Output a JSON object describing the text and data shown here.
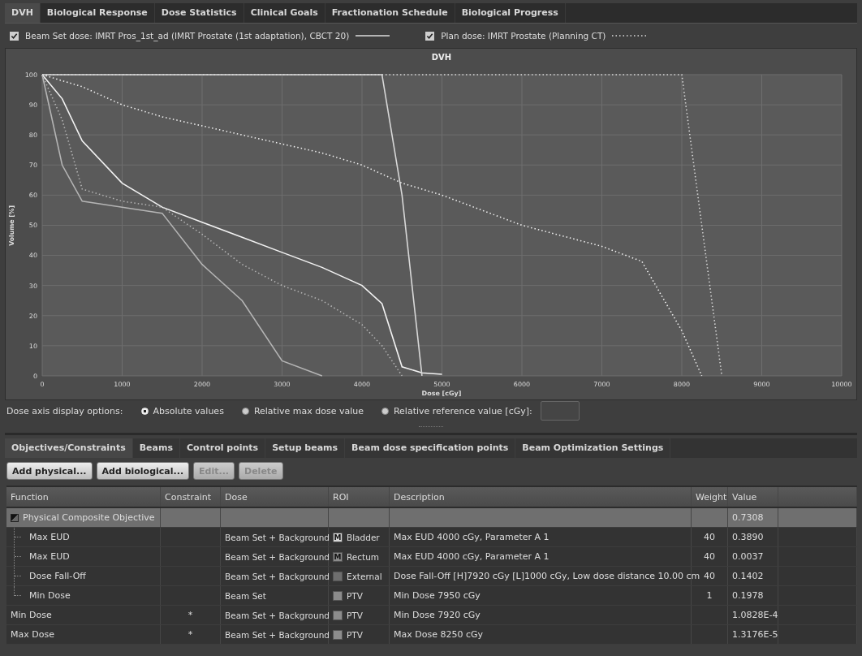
{
  "tabs": [
    {
      "label": "DVH",
      "selected": true
    },
    {
      "label": "Biological Response",
      "selected": false
    },
    {
      "label": "Dose Statistics",
      "selected": false
    },
    {
      "label": "Clinical Goals",
      "selected": false
    },
    {
      "label": "Fractionation Schedule",
      "selected": false
    },
    {
      "label": "Biological Progress",
      "selected": false
    }
  ],
  "legend": [
    {
      "label": "Beam Set dose: IMRT Pros_1st_ad (IMRT Prostate (1st adaptation), CBCT 20)",
      "checked": true,
      "dotted": false
    },
    {
      "label": "Plan dose: IMRT Prostate (Planning CT)",
      "checked": true,
      "dotted": true
    }
  ],
  "dvh": {
    "chart_data": {
      "type": "line",
      "title": "DVH",
      "xlabel": "Dose [cGy]",
      "ylabel": "Volume [%]",
      "xlim": [
        0,
        10000
      ],
      "ylim": [
        0,
        100
      ],
      "grid": true,
      "xticks": [
        0,
        1000,
        2000,
        3000,
        4000,
        5000,
        6000,
        7000,
        8000,
        9000,
        10000
      ],
      "yticks": [
        0,
        10,
        20,
        30,
        40,
        50,
        60,
        70,
        80,
        90,
        100
      ],
      "x": [
        0,
        250,
        500,
        1000,
        1500,
        2000,
        2500,
        3000,
        3500,
        4000,
        4250,
        4500,
        4750,
        5000,
        6000,
        7000,
        7500,
        8000,
        8250,
        8500
      ],
      "series": [
        {
          "color": "#f2f2f2",
          "line_style": "solid",
          "values": [
            100,
            92,
            78,
            64,
            56,
            51,
            46,
            41,
            36,
            30,
            24,
            3,
            1,
            0.5,
            null,
            null,
            null,
            null,
            null,
            null
          ]
        },
        {
          "color": "#b4b4b4",
          "line_style": "solid",
          "values": [
            100,
            70,
            58,
            56,
            54,
            37,
            25,
            5,
            0,
            null,
            null,
            null,
            null,
            null,
            null,
            null,
            null,
            null,
            null,
            null
          ]
        },
        {
          "color": "#d8d8d8",
          "line_style": "solid",
          "values": [
            100,
            100,
            100,
            100,
            100,
            100,
            100,
            100,
            100,
            100,
            100,
            60,
            0,
            null,
            null,
            null,
            null,
            null,
            null,
            null
          ]
        },
        {
          "color": "#b4b4b4",
          "line_style": "dotted",
          "values": [
            100,
            85,
            62,
            58,
            56,
            47,
            37,
            30,
            25,
            17,
            10,
            0,
            null,
            null,
            null,
            null,
            null,
            null,
            null,
            null
          ]
        },
        {
          "color": "#f2f2f2",
          "line_style": "dotted",
          "values": [
            100,
            98,
            96,
            90,
            86,
            83,
            80,
            77,
            74,
            70,
            67,
            64,
            62,
            60,
            50,
            43,
            38,
            15,
            0,
            null
          ]
        },
        {
          "color": "#d8d8d8",
          "line_style": "dotted",
          "values": [
            100,
            100,
            100,
            100,
            100,
            100,
            100,
            100,
            100,
            100,
            100,
            100,
            100,
            100,
            100,
            100,
            100,
            100,
            50,
            0
          ]
        }
      ]
    }
  },
  "dose_axis": {
    "label": "Dose axis display options:",
    "options": [
      {
        "label": "Absolute values",
        "selected": true
      },
      {
        "label": "Relative max dose value",
        "selected": false
      },
      {
        "label": "Relative reference value [cGy]:",
        "selected": false
      }
    ]
  },
  "bottom_tabs": [
    {
      "label": "Objectives/Constraints",
      "selected": true
    },
    {
      "label": "Beams",
      "selected": false
    },
    {
      "label": "Control points",
      "selected": false
    },
    {
      "label": "Setup beams",
      "selected": false
    },
    {
      "label": "Beam dose specification points",
      "selected": false
    },
    {
      "label": "Beam Optimization Settings",
      "selected": false
    }
  ],
  "buttons": [
    {
      "label": "Add physical...",
      "disabled": false
    },
    {
      "label": "Add biological...",
      "disabled": false
    },
    {
      "label": "Edit...",
      "disabled": true
    },
    {
      "label": "Delete",
      "disabled": true
    }
  ],
  "table": {
    "columns": [
      "Function",
      "Constraint",
      "Dose",
      "ROI",
      "Description",
      "Weight",
      "Value"
    ],
    "rows": [
      {
        "function": "Physical Composite Objective",
        "value": "0.7308",
        "selected": true,
        "expanded": true,
        "children": [
          {
            "function": "Max EUD",
            "dose": "Beam Set + Background",
            "roi": "Bladder",
            "color": "#d8d8d8",
            "roi_mark": "M",
            "description": "Max EUD 4000 cGy, Parameter A 1",
            "weight": "40",
            "value": "0.3890",
            "selected": false
          },
          {
            "function": "Max EUD",
            "dose": "Beam Set + Background",
            "roi": "Rectum",
            "color": "#8a8a8a",
            "roi_mark": "M",
            "description": "Max EUD 4000 cGy, Parameter A 1",
            "weight": "40",
            "value": "0.0037",
            "selected": false
          },
          {
            "function": "Dose Fall-Off",
            "dose": "Beam Set + Background",
            "roi": "External",
            "color": "#6e6e6e",
            "description": "Dose Fall-Off [H]7920 cGy [L]1000 cGy, Low dose distance 10.00 cm",
            "weight": "40",
            "value": "0.1402",
            "selected": false
          },
          {
            "function": "Min Dose",
            "dose": "Beam Set",
            "roi": "PTV",
            "color": "#8c8c8c",
            "description": "Min Dose 7950 cGy",
            "weight": "1",
            "value": "0.1978",
            "selected": false
          }
        ]
      },
      {
        "function": "Min Dose",
        "constraint": "*",
        "dose": "Beam Set + Background",
        "roi": "PTV",
        "color": "#8c8c8c",
        "description": "Min Dose 7920 cGy",
        "value": "1.0828E-4",
        "selected": false
      },
      {
        "function": "Max Dose",
        "constraint": "*",
        "dose": "Beam Set + Background",
        "roi": "PTV",
        "color": "#8c8c8c",
        "description": "Max Dose 8250 cGy",
        "value": "1.3176E-5",
        "selected": false
      }
    ]
  }
}
